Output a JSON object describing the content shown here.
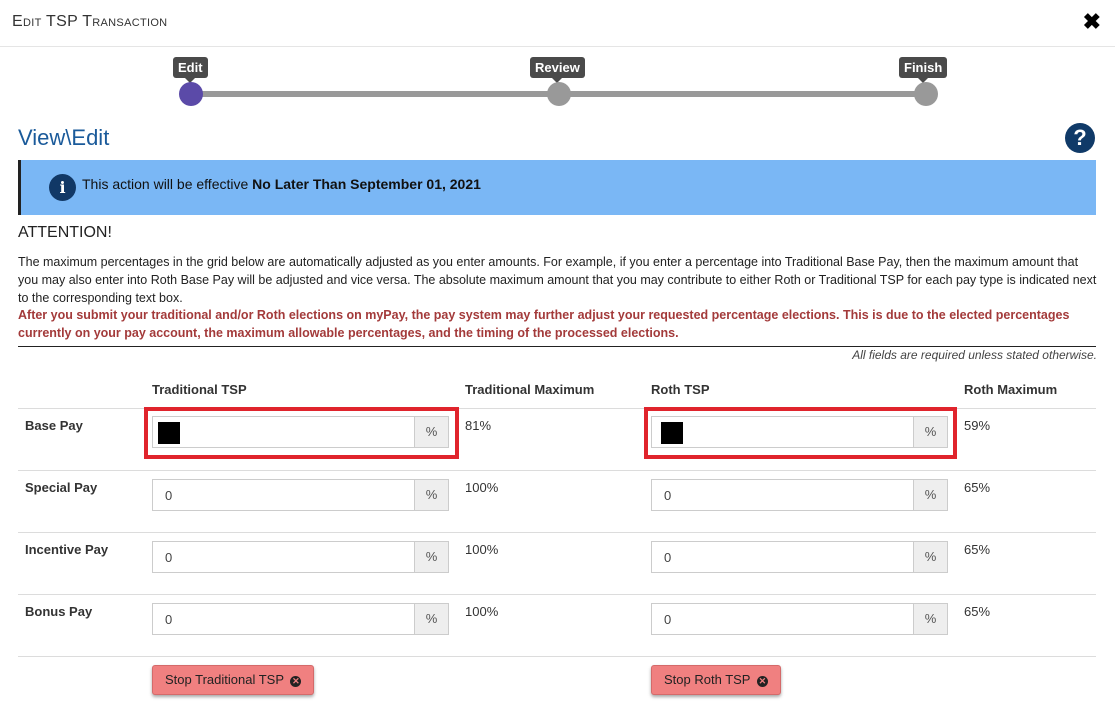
{
  "window": {
    "title": "Edit TSP Transaction",
    "close_icon": "✖"
  },
  "stepper": {
    "steps": [
      {
        "label": "Edit"
      },
      {
        "label": "Review"
      },
      {
        "label": "Finish"
      }
    ],
    "active_color": "#5b4aa8"
  },
  "page": {
    "heading": "View\\Edit",
    "help_icon": "?"
  },
  "alert": {
    "icon": "i",
    "text": "This action will be effective ",
    "bold": "No Later Than September 01, 2021"
  },
  "attention": {
    "title": "ATTENTION!",
    "body": "The maximum percentages in the grid below are automatically adjusted as you enter amounts. For example, if you enter a percentage into Traditional Base Pay, then the maximum amount that you may also enter into Roth Base Pay will be adjusted and vice versa. The absolute maximum amount that you may contribute to either Roth or Traditional TSP for each pay type is indicated next to the corresponding text box.",
    "warning": "After you submit your traditional and/or Roth elections on myPay, the pay system may further adjust your requested percentage elections. This is due to the elected percentages currently on your pay account, the maximum allowable percentages, and the timing of the processed elections.",
    "required_note": "All fields are required unless stated otherwise."
  },
  "grid": {
    "headers": {
      "traditional": "Traditional TSP",
      "traditional_max": "Traditional Maximum",
      "roth": "Roth TSP",
      "roth_max": "Roth Maximum"
    },
    "percent_symbol": "%",
    "rows": [
      {
        "label": "Base Pay",
        "traditional": "",
        "traditional_max": "81%",
        "roth": "",
        "roth_max": "59%"
      },
      {
        "label": "Special Pay",
        "traditional": "0",
        "traditional_max": "100%",
        "roth": "0",
        "roth_max": "65%"
      },
      {
        "label": "Incentive Pay",
        "traditional": "0",
        "traditional_max": "100%",
        "roth": "0",
        "roth_max": "65%"
      },
      {
        "label": "Bonus Pay",
        "traditional": "0",
        "traditional_max": "100%",
        "roth": "0",
        "roth_max": "65%"
      }
    ]
  },
  "buttons": {
    "stop_traditional": "Stop Traditional TSP",
    "stop_roth": "Stop Roth TSP",
    "stop_icon": "✕"
  }
}
